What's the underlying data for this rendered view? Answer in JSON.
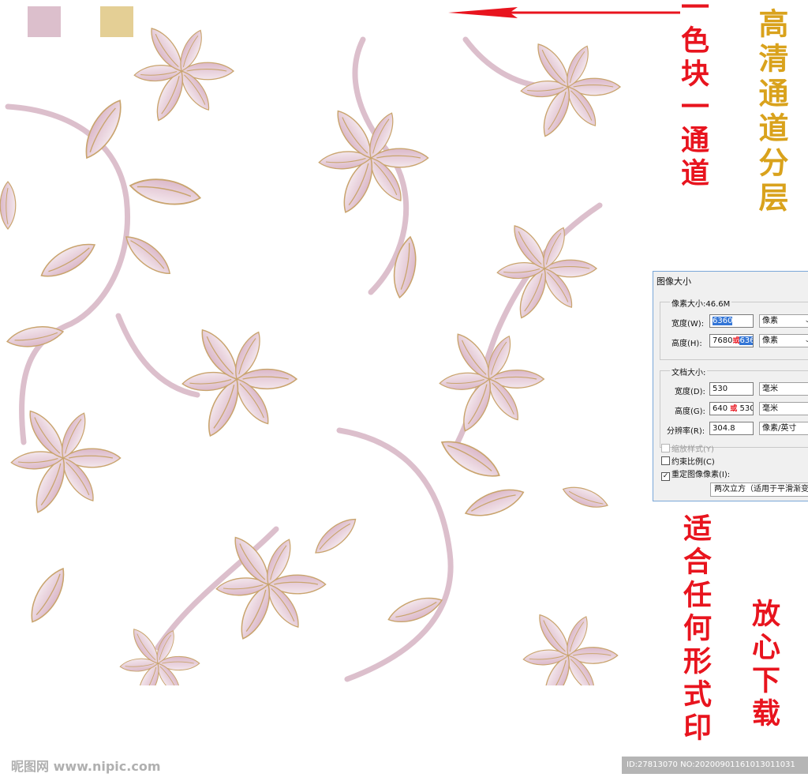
{
  "colors": {
    "swatch_pink": "#dcbfcc",
    "swatch_gold": "#e4cf95",
    "petal_fill": "#e3c5d2",
    "petal_outline": "#c9a46e",
    "arrow": "#e8141e",
    "gold_text": "#d9a21c",
    "red_text": "#e8141e"
  },
  "overlay": {
    "gold_vertical": "高清通道分层",
    "red_left_col": "一色块一通道",
    "red_bottom_col_1": "适合任何形式印",
    "red_bottom_col_2": "放心下载"
  },
  "dialog": {
    "title": "图像大小",
    "pixel_size_label": "像素大小:46.6M",
    "width_label": "宽度(W):",
    "width_value": "6360",
    "width_unit": "像素",
    "height_label": "高度(H):",
    "height_value_old": "7680",
    "height_or": "或",
    "height_value_new": "6360",
    "height_unit": "像素",
    "doc_size_label": "文档大小:",
    "doc_width_label": "宽度(D):",
    "doc_width_value": "530",
    "doc_width_unit": "毫米",
    "doc_height_label": "高度(G):",
    "doc_height_value_old": "640",
    "doc_height_or": "或",
    "doc_height_value_new": "530",
    "doc_height_unit": "毫米",
    "resolution_label": "分辨率(R):",
    "resolution_value": "304.8",
    "resolution_unit": "像素/英寸",
    "scale_styles_label": "缩放样式(Y)",
    "constrain_label": "约束比例(C)",
    "resample_label": "重定图像像素(I):",
    "resample_method": "两次立方（适用于平滑渐变"
  },
  "footer": {
    "logo_text": "昵图网 www.nipic.com",
    "id_text": "ID:27813070 NO:20200901161013011031"
  }
}
